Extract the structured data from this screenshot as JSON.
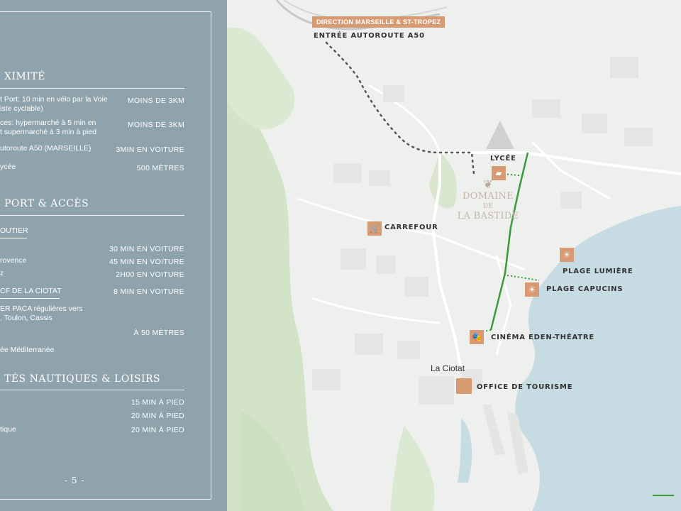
{
  "page_number": "- 5 -",
  "sections": {
    "proximite": {
      "title": "XIMITÉ",
      "items": [
        {
          "l1": "t Port: 10 min en vélo par la Voie",
          "l2": "iste cyclable)",
          "value": "MOINS DE 3KM"
        },
        {
          "l1": "ces: hypermarché à 5 min en",
          "l2": "t supermarché à 3 min à pied",
          "value": "MOINS DE 3KM"
        },
        {
          "l1": "utoroute A50 (MARSEILLE)",
          "l2": "",
          "value": "3MIN EN VOITURE"
        },
        {
          "l1": "ycée",
          "l2": "",
          "value": "500 MÈTRES"
        }
      ]
    },
    "transport": {
      "title": "PORT & ACCÈS",
      "subheading": "OUTIER",
      "values": [
        "30 MIN EN VOITURE",
        "45 MIN EN VOITURE",
        "2H00 EN VOITURE",
        "8 MIN EN VOITURE",
        "À 50 MÈTRES"
      ],
      "labels": [
        "rovence",
        "z",
        "CF DE LA CIOTAT",
        "ER PACA régulières vers",
        ", Toulon, Cassis",
        "ée Méditerranée"
      ]
    },
    "nautique": {
      "title": "TÉS NAUTIQUES & LOISIRS",
      "values": [
        "15 MIN À PIED",
        "20 MIN À PIED",
        "20 MIN À PIED"
      ],
      "labels": [
        "tique"
      ]
    }
  },
  "map": {
    "direction_badge": "DIRECTION MARSEILLE & ST-TROPEZ",
    "entree_label": "ENTRÉE AUTOROUTE A50",
    "town": "La Ciotat",
    "domaine": {
      "line1": "DOMAINE",
      "line2": "DE",
      "line3": "LA BASTIDE"
    },
    "pois": {
      "lycee": "LYCÉE",
      "carrefour": "CARREFOUR",
      "plage_lumiere": "PLAGE LUMIÈRE",
      "plage_capucins": "PLAGE CAPUCINS",
      "cinema": "CINÉMA EDEN-THÉATRE",
      "office": "OFFICE DE TOURISME"
    }
  },
  "colors": {
    "panel": "#8ea3ab",
    "poi": "#d89a73",
    "route": "#3a9a3a",
    "sea": "#c7dbe3",
    "green_area": "#cfe1c3"
  }
}
